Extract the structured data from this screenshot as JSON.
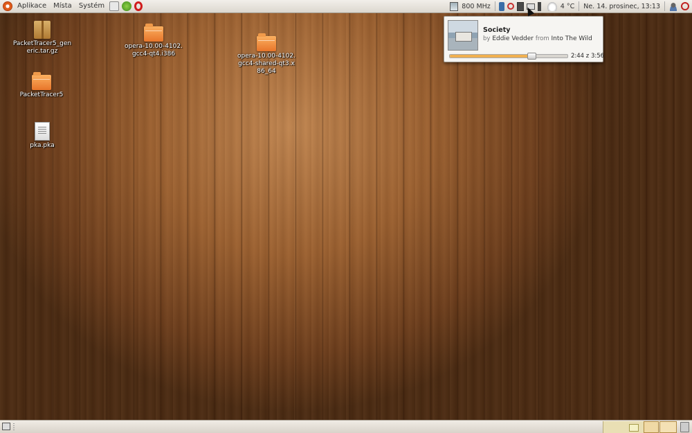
{
  "top_panel": {
    "menus": [
      "Aplikace",
      "Místa",
      "Systém"
    ],
    "cpu_freq": "800 MHz",
    "temperature": "4 °C",
    "clock": "Ne. 14. prosinec, 13:13"
  },
  "desktop_icons": [
    {
      "label": "PacketTracer5_generic.tar.gz",
      "type": "archive"
    },
    {
      "label": "PacketTracer5",
      "type": "folder"
    },
    {
      "label": "pka.pka",
      "type": "document"
    },
    {
      "label": "opera-10.00-4102.gcc4-qt4.i386",
      "type": "folder"
    },
    {
      "label": "opera-10.00-4102.gcc4-shared-qt3.x86_64",
      "type": "folder"
    }
  ],
  "music_popup": {
    "title": "Society",
    "by_word": "by",
    "artist": "Eddie Vedder",
    "from_word": "from",
    "album": "Into The Wild",
    "time_readout": "2:44 z 3:56",
    "progress": 0.69
  },
  "colors": {
    "accent": "#e8752a",
    "panel": "#e6e1d9",
    "progress": "#f0b050"
  }
}
